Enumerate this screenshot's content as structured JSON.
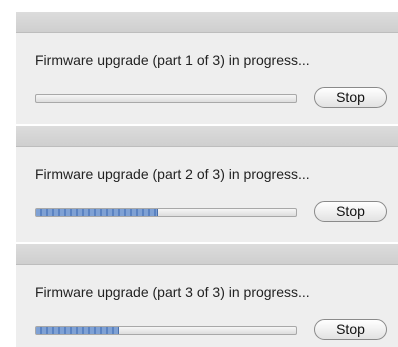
{
  "dialogs": [
    {
      "message": "Firmware upgrade (part 1 of 3) in progress...",
      "progress": 0.0,
      "stop_label": "Stop"
    },
    {
      "message": "Firmware upgrade (part 2 of 3) in progress...",
      "progress": 0.47,
      "stop_label": "Stop"
    },
    {
      "message": "Firmware upgrade (part 3 of 3) in progress...",
      "progress": 0.32,
      "stop_label": "Stop"
    }
  ],
  "colors": {
    "progress_fill": "#6f93cd",
    "window_bg": "#eeeeee"
  }
}
